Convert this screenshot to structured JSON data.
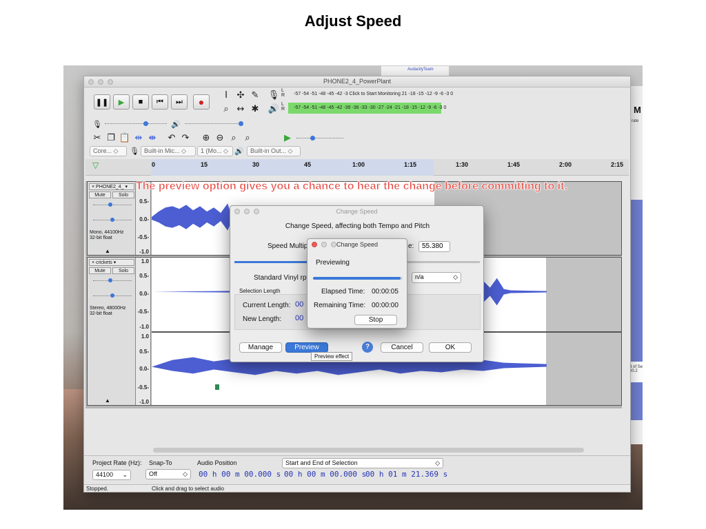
{
  "slide": {
    "title": "Adjust Speed"
  },
  "annotation": "The preview option gives you a chance to hear the change before committing to it.",
  "colors": {
    "accent": "#3b78d8",
    "waveform": "#4c5ed1",
    "annotation": "#e8473f",
    "meter_green": "#7bd96b",
    "timecode": "#2333b4"
  },
  "background_window": {
    "label": "AudacityTeam"
  },
  "right_panel": {
    "bold_text": "M",
    "small_text": "rate",
    "tag_text": "d of Se 00.2"
  },
  "window": {
    "title": "PHONE2_4_PowerPlant"
  },
  "meters": {
    "record_scale": "-57 -54 -51 -48 -45 -42 -3 Click to Start Monitoring 21 -18 -15 -12 -9 -6 -3 0",
    "play_scale": "-57 -54 -51 -48 -45 -42 -39 -36 -33 -30 -27 -24 -21 -18 -15 -12 -9 -6 -3 0",
    "lr": [
      "L",
      "R"
    ]
  },
  "device_toolbar": {
    "host": "Core...",
    "input": "Built-in Mic...",
    "channels": "1 (Mo...",
    "output": "Built-in Out..."
  },
  "timeline": {
    "ticks": [
      "0",
      "15",
      "30",
      "45",
      "1:00",
      "1:15",
      "1:30",
      "1:45",
      "2:00",
      "2:15"
    ]
  },
  "tracks": [
    {
      "name": "PHONE2_4_",
      "mute": "Mute",
      "solo": "Solo",
      "info": [
        "Mono, 44100Hz",
        "32-bit float"
      ],
      "scale": [
        "0.5-",
        "0.0-",
        "-0.5-",
        "-1.0"
      ]
    },
    {
      "name": "crickets",
      "mute": "Mute",
      "solo": "Solo",
      "info": [
        "Stereo, 48000Hz",
        "32-bit float"
      ],
      "scale": [
        "1.0",
        "0.5-",
        "0.0-",
        "-0.5-",
        "-1.0"
      ],
      "scale2": [
        "1.0",
        "0.5-",
        "0.0-",
        "-0.5-",
        "-1.0"
      ]
    }
  ],
  "change_speed_dialog": {
    "title": "Change Speed",
    "heading": "Change Speed, affecting both Tempo and Pitch",
    "speed_label": "Speed Multip",
    "speed_suffix": "e:",
    "speed_value": "55.380",
    "vinyl_label": "Standard Vinyl rpm",
    "vinyl_value": "n/a",
    "selection_length": "Selection Length",
    "current_length": "Current Length:",
    "current_value": "00",
    "new_length": "New Length:",
    "new_value": "00",
    "manage": "Manage",
    "preview": "Preview",
    "help": "?",
    "cancel": "Cancel",
    "ok": "OK",
    "tooltip": "Preview effect"
  },
  "progress_dialog": {
    "title": "Change Speed",
    "label": "Previewing",
    "elapsed_label": "Elapsed Time:",
    "elapsed_value": "00:00:05",
    "remaining_label": "Remaining Time:",
    "remaining_value": "00:00:00",
    "stop": "Stop",
    "progress": 0.98
  },
  "bottom": {
    "project_rate_label": "Project Rate (Hz):",
    "project_rate": "44100",
    "snap_label": "Snap-To",
    "snap_value": "Off",
    "audio_position_label": "Audio Position",
    "audio_position": "00 h 00 m 00.000 s",
    "selection_mode": "Start and End of Selection",
    "sel_start": "00 h 00 m 00.000 s",
    "sel_end": "00 h 01 m 21.369 s"
  },
  "status": {
    "left": "Stopped.",
    "hint": "Click and drag to select audio"
  }
}
